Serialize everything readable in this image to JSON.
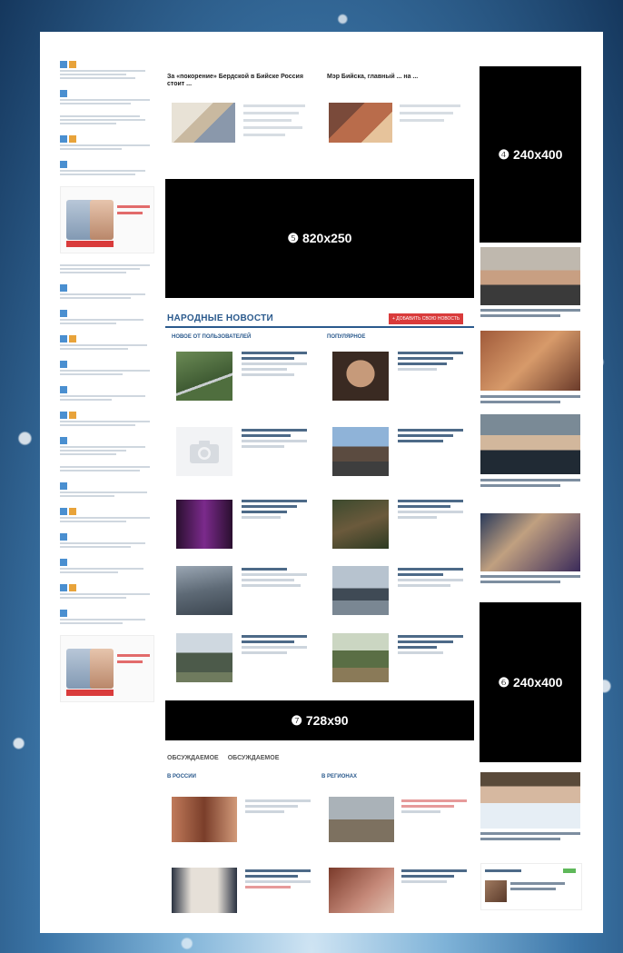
{
  "ads": {
    "ad4": "❹ 240x400",
    "ad5": "❺ 820x250",
    "ad6": "❻ 240x400",
    "ad7": "❼ 728x90"
  },
  "colors": {
    "banner_bg": "#000000",
    "accent_red": "#d93b3b",
    "section_blue": "#2b5a8d",
    "tag_blue": "#4a8fd0",
    "tag_orange": "#e8a33a"
  },
  "top_news": {
    "headline_1": "За «покорение» Бердской в Бийске Россия стоит ...",
    "headline_2": "Мэр Бийска, главный ... на ..."
  },
  "people_news": {
    "title": "НАРОДНЫЕ НОВОСТИ",
    "button": "+ ДОБАВИТЬ СВОЮ НОВОСТЬ",
    "col_left": "НОВОЕ ОТ ПОЛЬЗОВАТЕЛЕЙ",
    "col_right": "ПОПУЛЯРНОЕ"
  },
  "bottom": {
    "tab_1": "ОБСУЖДАЕМОЕ",
    "tab_2": "ОБСУЖДАЕМОЕ",
    "region_left": "В РОССИИ",
    "region_right": "В РЕГИОНАХ"
  },
  "left_tags": [
    "",
    "",
    "",
    "",
    "",
    ""
  ],
  "icons": [
    "camera-icon"
  ]
}
